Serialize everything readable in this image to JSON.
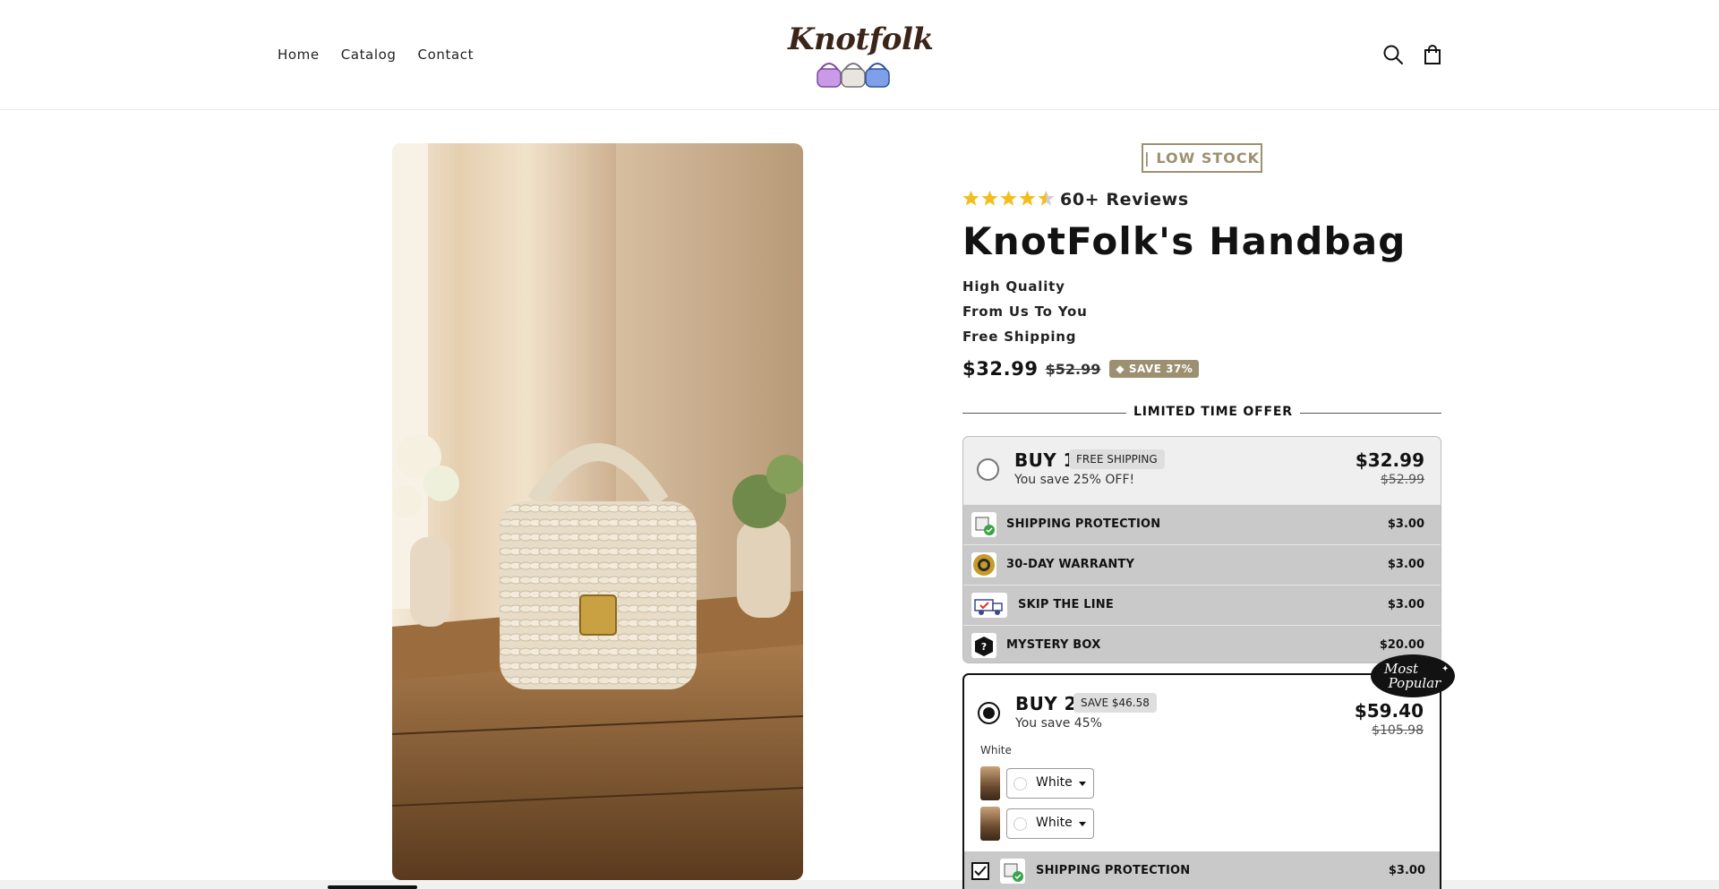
{
  "nav": {
    "home": "Home",
    "catalog": "Catalog",
    "contact": "Contact"
  },
  "logo": {
    "text": "Knotfolk"
  },
  "header_icons": [
    "search-icon",
    "cart-icon"
  ],
  "product": {
    "stock_badge": "| LOW STOCK",
    "rating": 4.5,
    "reviews": "60+ Reviews",
    "title": "KnotFolk's Handbag",
    "features": [
      "High Quality",
      "From Us To You",
      "Free Shipping"
    ],
    "price": "$32.99",
    "compare_price": "$52.99",
    "save_badge": "SAVE 37%"
  },
  "offer": {
    "label": "LIMITED TIME OFFER",
    "bundles": [
      {
        "title": "BUY 1",
        "pill": "FREE SHIPPING",
        "subtitle": "You save 25% OFF!",
        "price": "$32.99",
        "compare_price": "$52.99",
        "selected": false,
        "addons": [
          {
            "label": "SHIPPING PROTECTION",
            "price": "$3.00",
            "icon": "shipping-protection-icon"
          },
          {
            "label": "30-DAY WARRANTY",
            "price": "$3.00",
            "icon": "warranty-seal-icon"
          },
          {
            "label": "SKIP THE LINE",
            "price": "$3.00",
            "icon": "delivery-truck-icon"
          },
          {
            "label": "MYSTERY BOX",
            "price": "$20.00",
            "icon": "mystery-box-icon"
          }
        ]
      },
      {
        "title": "BUY 2",
        "pill": "SAVE $46.58",
        "subtitle": "You save 45%",
        "price": "$59.40",
        "compare_price": "$105.98",
        "selected": true,
        "badge": "Most Popular",
        "color_label": "White",
        "variants": [
          "White",
          "White"
        ],
        "addons": [
          {
            "label": "SHIPPING PROTECTION",
            "price": "$3.00",
            "icon": "shipping-protection-icon",
            "checked": true
          }
        ]
      }
    ]
  },
  "colors": {
    "accent": "#9c9070",
    "text": "#121212",
    "addon_bg": "#c9c9c9"
  }
}
